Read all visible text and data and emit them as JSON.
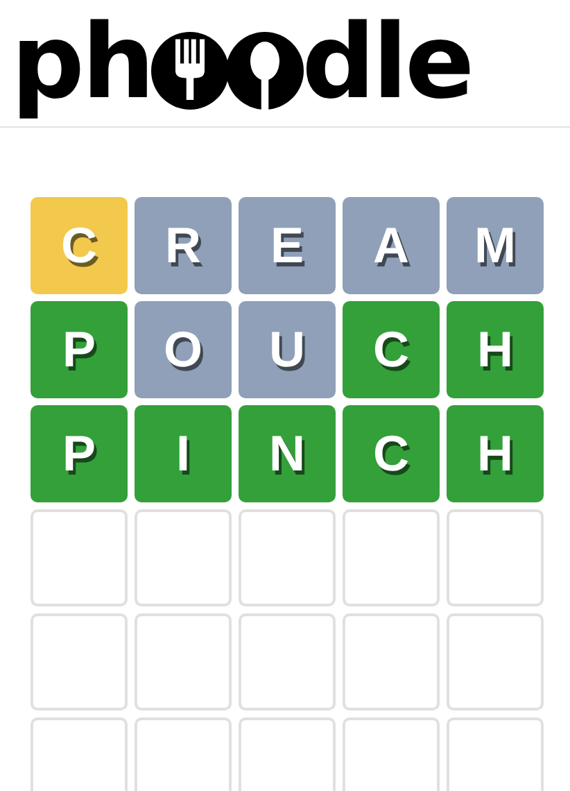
{
  "logo": {
    "before": "ph",
    "after": "dle"
  },
  "rows": [
    {
      "tiles": [
        {
          "letter": "C",
          "kind": "present"
        },
        {
          "letter": "R",
          "kind": "absent"
        },
        {
          "letter": "E",
          "kind": "absent"
        },
        {
          "letter": "A",
          "kind": "absent"
        },
        {
          "letter": "M",
          "kind": "absent"
        }
      ]
    },
    {
      "tiles": [
        {
          "letter": "P",
          "kind": "correct"
        },
        {
          "letter": "O",
          "kind": "absent"
        },
        {
          "letter": "U",
          "kind": "absent"
        },
        {
          "letter": "C",
          "kind": "correct"
        },
        {
          "letter": "H",
          "kind": "correct"
        }
      ]
    },
    {
      "tiles": [
        {
          "letter": "P",
          "kind": "correct"
        },
        {
          "letter": "I",
          "kind": "correct"
        },
        {
          "letter": "N",
          "kind": "correct"
        },
        {
          "letter": "C",
          "kind": "correct"
        },
        {
          "letter": "H",
          "kind": "correct"
        }
      ]
    },
    {
      "tiles": [
        {
          "kind": "empty"
        },
        {
          "kind": "empty"
        },
        {
          "kind": "empty"
        },
        {
          "kind": "empty"
        },
        {
          "kind": "empty"
        }
      ]
    },
    {
      "tiles": [
        {
          "kind": "empty"
        },
        {
          "kind": "empty"
        },
        {
          "kind": "empty"
        },
        {
          "kind": "empty"
        },
        {
          "kind": "empty"
        }
      ]
    },
    {
      "tiles": [
        {
          "kind": "empty"
        },
        {
          "kind": "empty"
        },
        {
          "kind": "empty"
        },
        {
          "kind": "empty"
        },
        {
          "kind": "empty"
        }
      ]
    }
  ]
}
